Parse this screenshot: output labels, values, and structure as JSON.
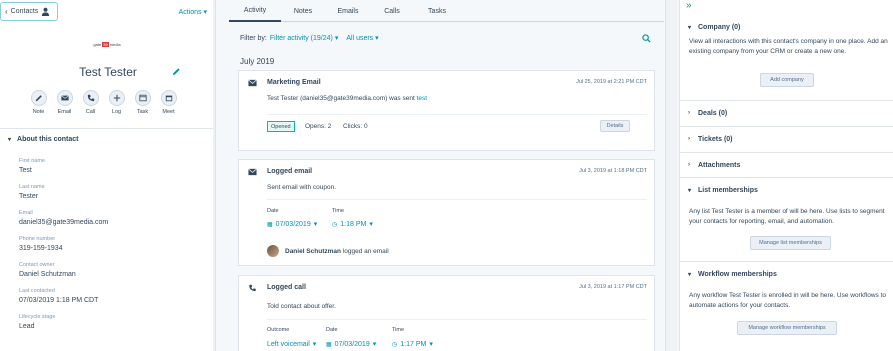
{
  "left": {
    "contacts_label": "Contacts",
    "actions_label": "Actions",
    "logo": {
      "pre": "gate",
      "mid": "39",
      "post": "media"
    },
    "contact_name": "Test Tester",
    "quick_actions": [
      "Note",
      "Email",
      "Call",
      "Log",
      "Task",
      "Meet"
    ],
    "about_title": "About this contact",
    "properties": [
      {
        "label": "First name",
        "value": "Test"
      },
      {
        "label": "Last name",
        "value": "Tester"
      },
      {
        "label": "Email",
        "value": "daniel35@gate39media.com"
      },
      {
        "label": "Phone number",
        "value": "319-159-1934"
      },
      {
        "label": "Contact owner",
        "value": "Daniel Schutzman"
      },
      {
        "label": "Last contacted",
        "value": "07/03/2019 1:18 PM CDT"
      },
      {
        "label": "Lifecycle stage",
        "value": "Lead"
      }
    ]
  },
  "center": {
    "tabs": [
      "Activity",
      "Notes",
      "Emails",
      "Calls",
      "Tasks"
    ],
    "active_tab": "Activity",
    "filter_label": "Filter by:",
    "filter_activity": "Filter activity (19/24)",
    "filter_users": "All users",
    "month": "July 2019",
    "marketing_email": {
      "title": "Marketing Email",
      "date": "Jul 25, 2019 at 2:21 PM CDT",
      "body_prefix": "Test Tester (daniel35@gate39media.com) was sent",
      "body_link": "test",
      "status": "Opened",
      "opens": "Opens: 2",
      "clicks": "Clicks: 0",
      "details": "Details"
    },
    "logged_email": {
      "title": "Logged email",
      "date": "Jul 3, 2019 at 1:18 PM CDT",
      "body": "Sent email with coupon.",
      "date_label": "Date",
      "date_value": "07/03/2019",
      "time_label": "Time",
      "time_value": "1:18 PM",
      "author_name": "Daniel Schutzman",
      "author_action": "logged an email"
    },
    "logged_call": {
      "title": "Logged call",
      "date": "Jul 3, 2019 at 1:17 PM CDT",
      "body": "Told contact about offer.",
      "outcome_label": "Outcome",
      "outcome_value": "Left voicemail",
      "date_label": "Date",
      "date_value": "07/03/2019",
      "time_label": "Time",
      "time_value": "1:17 PM"
    }
  },
  "right": {
    "company": {
      "title": "Company (0)",
      "desc": "View all interactions with this contact's company in one place. Add an existing company from your CRM or create a new one.",
      "button": "Add company"
    },
    "deals": "Deals (0)",
    "tickets": "Tickets (0)",
    "attachments": "Attachments",
    "lists": {
      "title": "List memberships",
      "desc": "Any list Test Tester is a member of will be here. Use lists to segment your contacts for reporting, email, and automation.",
      "button": "Manage list memberships"
    },
    "workflows": {
      "title": "Workflow memberships",
      "desc": "Any workflow Test Tester is enrolled in will be here. Use workflows to automate actions for your contacts.",
      "button": "Manage workflow memberships"
    }
  },
  "colors": {
    "accent": "#0091ae",
    "text": "#33475b",
    "teal_border": "#00bda5"
  }
}
